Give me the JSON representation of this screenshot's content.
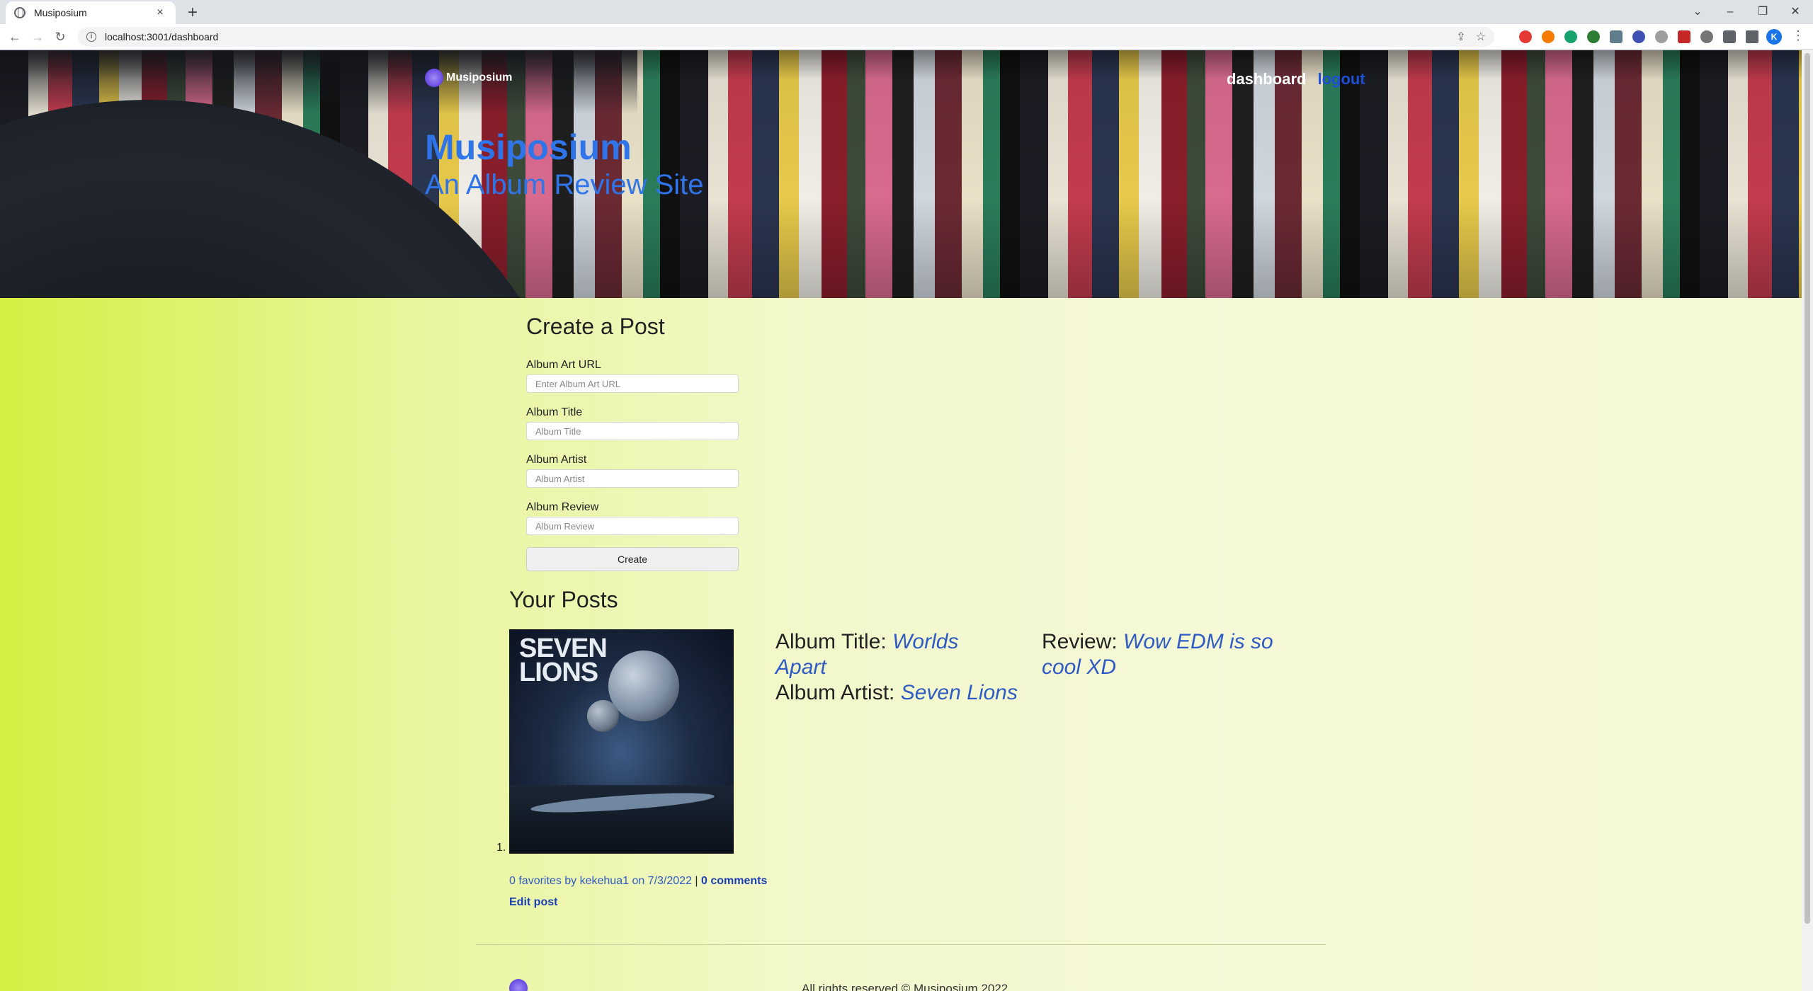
{
  "browser": {
    "tab_title": "Musiposium",
    "tab_close": "×",
    "new_tab": "+",
    "url": "localhost:3001/dashboard",
    "profile_initial": "K"
  },
  "site": {
    "brand": "Musiposium",
    "nav": {
      "dashboard": "dashboard",
      "logout": "logout"
    },
    "hero_title": "Musiposium",
    "hero_subtitle": "An Album Review Site"
  },
  "create_form": {
    "heading": "Create a Post",
    "fields": [
      {
        "label": "Album Art URL",
        "placeholder": "Enter Album Art URL"
      },
      {
        "label": "Album Title",
        "placeholder": "Album Title"
      },
      {
        "label": "Album Artist",
        "placeholder": "Album Artist"
      },
      {
        "label": "Album Review",
        "placeholder": "Album Review"
      }
    ],
    "submit_label": "Create"
  },
  "posts": {
    "heading": "Your Posts",
    "items": [
      {
        "index": "1.",
        "cover_text": "SEVEN LIONS",
        "title_label": "Album Title:",
        "title": "Worlds Apart",
        "artist_label": "Album Artist:",
        "artist": "Seven Lions",
        "review_label": "Review:",
        "review": "Wow EDM is so cool XD",
        "byline": "0 favorites by kekehua1 on 7/3/2022",
        "separator": "|",
        "comments": "0 comments",
        "edit": "Edit post"
      }
    ]
  },
  "footer": {
    "text": "All rights reserved © Musiposium 2022"
  },
  "colors": {
    "link_blue": "#2f5bc4",
    "hero_blue": "#2f74e8",
    "page_green": "#d5ef44"
  }
}
